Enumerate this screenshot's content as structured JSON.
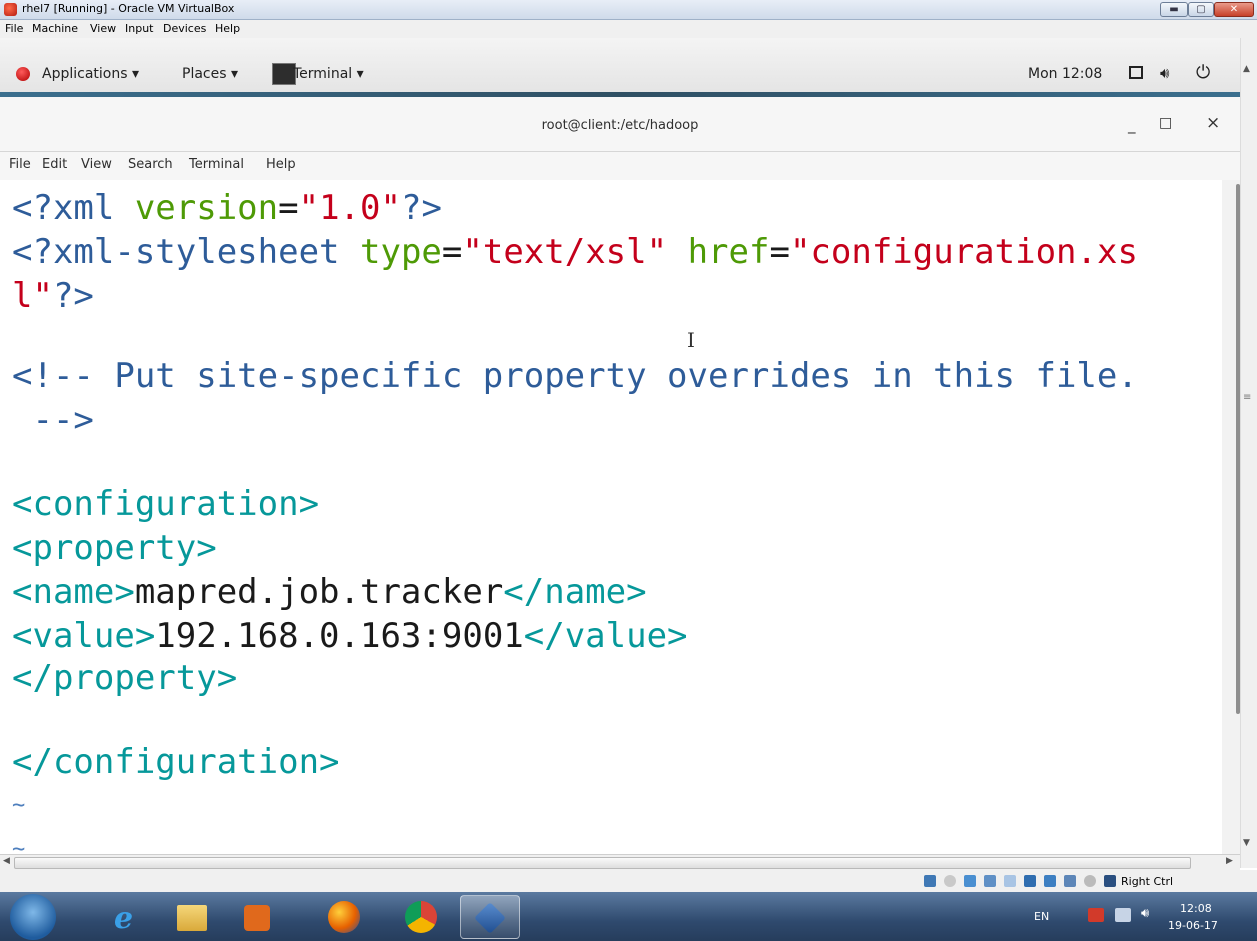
{
  "vbox": {
    "title": "rhel7 [Running] - Oracle VM VirtualBox",
    "menu": [
      "File",
      "Machine",
      "View",
      "Input",
      "Devices",
      "Help"
    ],
    "status_hostkey": "Right Ctrl"
  },
  "gnome": {
    "applications": "Applications ▾",
    "places": "Places ▾",
    "terminal": "Terminal ▾",
    "clock": "Mon 12:08"
  },
  "terminal": {
    "title": "root@client:/etc/hadoop",
    "menu": [
      "File",
      "Edit",
      "View",
      "Search",
      "Terminal",
      "Help"
    ],
    "minimize": "_",
    "maximize": "□",
    "close": "×"
  },
  "code": {
    "l1": {
      "a": "<?xml ",
      "b": "version",
      "c": "=",
      "d": "\"1.0\"",
      "e": "?>"
    },
    "l2": {
      "a": "<?xml-stylesheet ",
      "b": "type",
      "c": "=",
      "d": "\"text/xsl\"",
      "e": " ",
      "f": "href",
      "g": "=",
      "h": "\"configuration.xs"
    },
    "l3": {
      "a": "l\"",
      "b": "?>"
    },
    "l5": "<!-- Put site-specific property overrides in this file.",
    "l6": " -->",
    "l8": "<configuration>",
    "l9": "<property>",
    "l10": {
      "a": "<name>",
      "b": "mapred.job.tracker",
      "c": "</name>"
    },
    "l11": {
      "a": "<value>",
      "b": "192.168.0.163:9001",
      "c": "</value>"
    },
    "l12": "</property>",
    "l14": "</configuration>",
    "tilde": "~"
  },
  "taskbar": {
    "lang": "EN",
    "time": "12:08",
    "date": "19-06-17"
  },
  "colors": {
    "xml_blue": "#2e5c99",
    "attr_green": "#4e9a06",
    "string_red": "#c4001b",
    "tag_teal": "#06989a"
  }
}
